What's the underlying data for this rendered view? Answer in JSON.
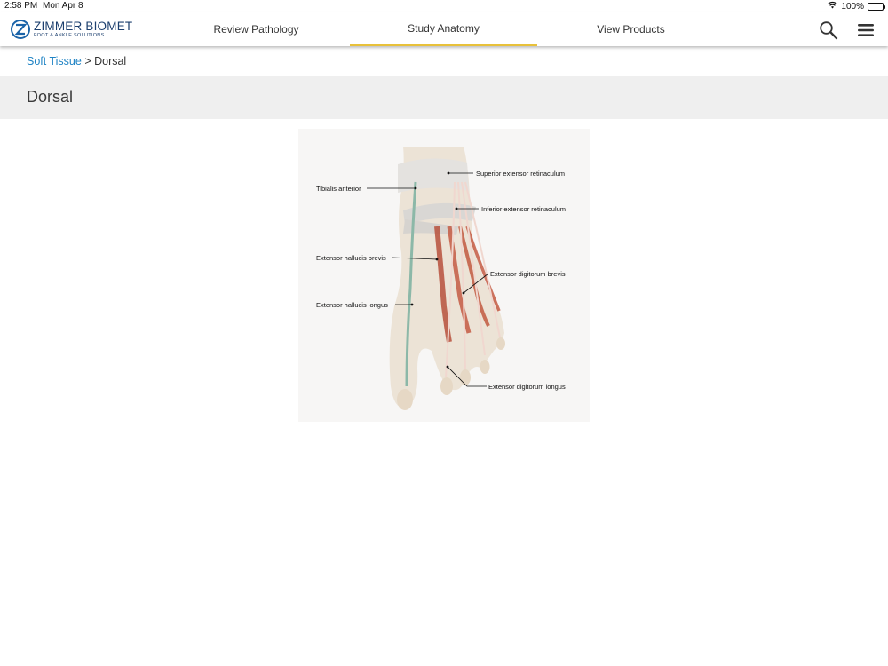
{
  "status": {
    "time": "2:58 PM",
    "date": "Mon Apr 8",
    "battery": "100%"
  },
  "brand": {
    "name": "ZIMMER BIOMET",
    "subtitle": "FOOT & ANKLE SOLUTIONS",
    "accent": "#1a63a8"
  },
  "nav": {
    "tabs": [
      {
        "label": "Review Pathology",
        "active": false
      },
      {
        "label": "Study Anatomy",
        "active": true
      },
      {
        "label": "View Products",
        "active": false
      }
    ],
    "active_color": "#e8c13a",
    "icons": [
      "search-icon",
      "menu-icon"
    ]
  },
  "breadcrumb": {
    "parent": "Soft Tissue",
    "separator": " > ",
    "current": "Dorsal"
  },
  "page": {
    "title": "Dorsal"
  },
  "figure": {
    "labels": {
      "superior_extensor_retinaculum": "Superior extensor retinaculum",
      "tibialis_anterior": "Tibialis anterior",
      "inferior_extensor_retinaculum": "Inferior extensor retinaculum",
      "extensor_hallucis_brevis": "Extensor hallucis brevis",
      "extensor_digitorum_brevis": "Extensor digitorum brevis",
      "extensor_hallucis_longus": "Extensor hallucis longus",
      "extensor_digitorum_longus": "Extensor digitorum longus"
    }
  }
}
